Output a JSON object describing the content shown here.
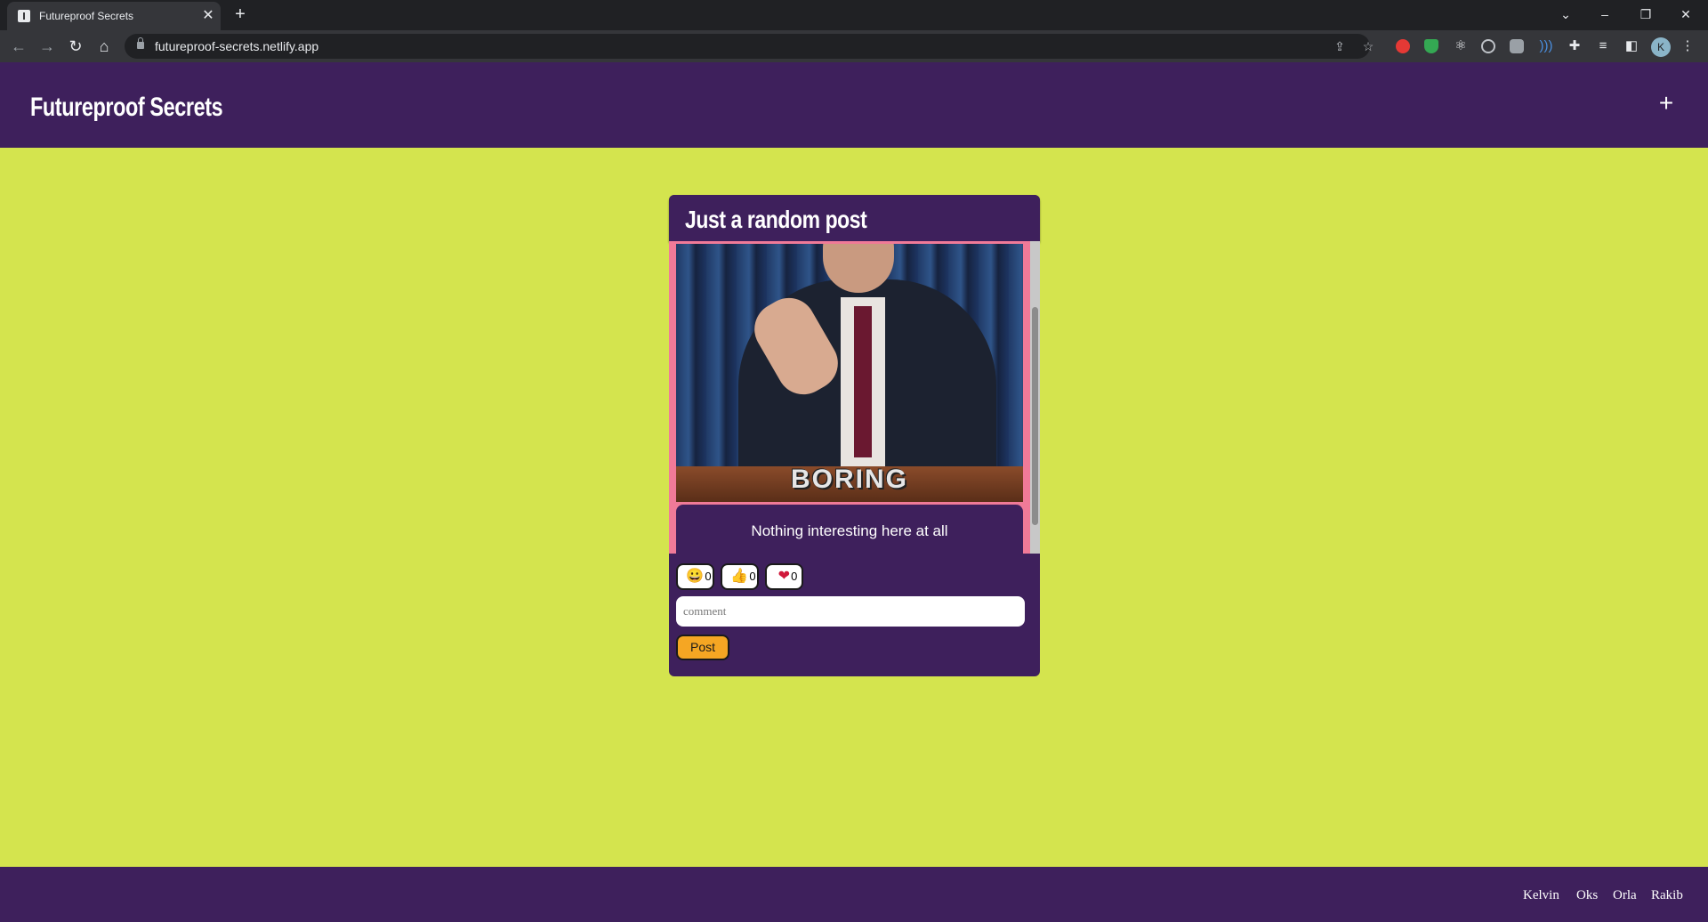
{
  "browser": {
    "tab_title": "Futureproof Secrets",
    "tab_close": "✕",
    "new_tab": "+",
    "url": "futureproof-secrets.netlify.app",
    "profile_initial": "K",
    "nav": {
      "back": "←",
      "forward": "→",
      "reload": "↻",
      "home": "⌂"
    },
    "window": {
      "tab_search": "⌄",
      "minimize": "–",
      "restore": "❐",
      "close": "✕"
    },
    "icons": [
      "share-icon",
      "bookmark-star-icon",
      "extension-red-icon",
      "extension-shield-icon",
      "extension-atom-icon",
      "extension-circle-icon",
      "extension-square-icon",
      "extension-wave-icon",
      "extensions-puzzle-icon",
      "media-control-icon",
      "side-panel-icon",
      "menu-icon"
    ]
  },
  "site": {
    "title": "Futureproof Secrets",
    "add_button": "+",
    "accent_colors": {
      "header": "#3e205c",
      "background": "#d4e44e",
      "frame": "#f07a98",
      "post_button": "#f5a623"
    }
  },
  "post": {
    "title": "Just a random post",
    "gif_caption": "BORING",
    "body": "Nothing interesting here at all",
    "reactions": [
      {
        "icon": "laugh-emoji-icon",
        "glyph": "😀",
        "count": "0"
      },
      {
        "icon": "thumbs-up-icon",
        "glyph": "👍",
        "count": "0"
      },
      {
        "icon": "heart-icon",
        "glyph": "❤",
        "count": "0"
      }
    ],
    "comment_placeholder": "comment",
    "post_button": "Post"
  },
  "footer": {
    "credits": [
      "Kelvin",
      "Oks",
      "Orla",
      "Rakib"
    ]
  }
}
